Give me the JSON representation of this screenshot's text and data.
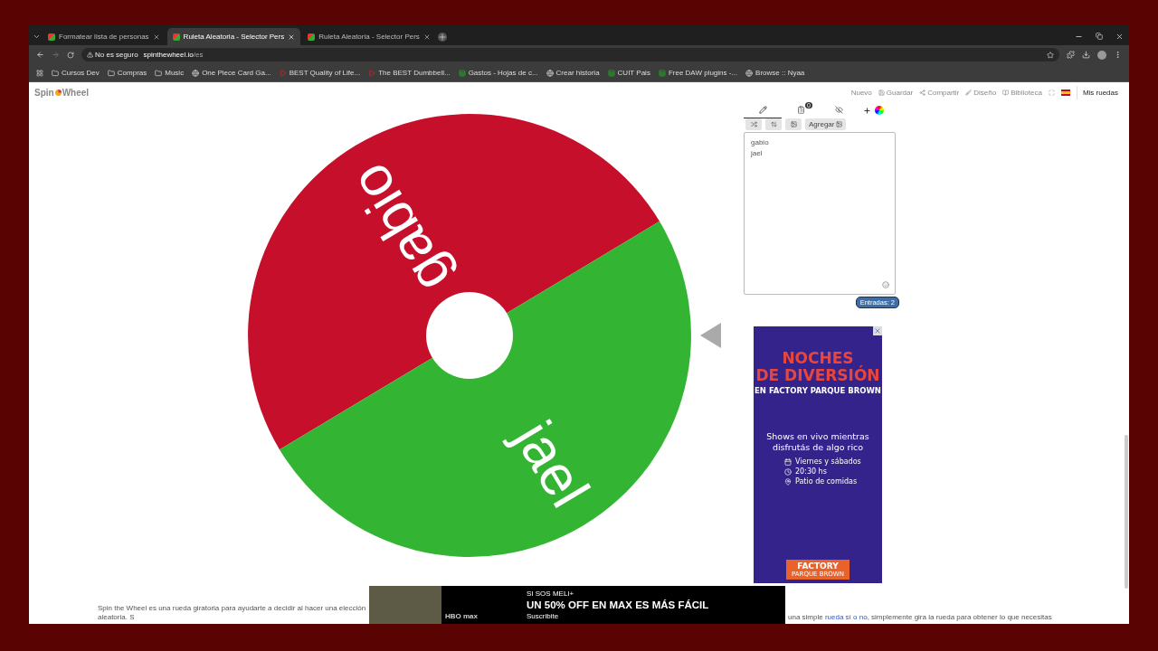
{
  "browser": {
    "tabs": [
      {
        "title": "Formatear lista de personas",
        "selected": false
      },
      {
        "title": "Ruleta Aleatoria - Selector Pers",
        "selected": true
      },
      {
        "title": "Ruleta Aleatoria - Selector Pers",
        "selected": false
      }
    ],
    "security_label": "No es seguro",
    "url_host": "spinthewheel.io",
    "url_path": "/es",
    "bookmarks": [
      {
        "label": "Cursos Dev",
        "kind": "folder"
      },
      {
        "label": "Compras",
        "kind": "folder"
      },
      {
        "label": "Music",
        "kind": "folder"
      },
      {
        "label": "One Piece Card Ga...",
        "kind": "page"
      },
      {
        "label": "BEST Quality of Life...",
        "kind": "video"
      },
      {
        "label": "The BEST Dumbbell...",
        "kind": "video"
      },
      {
        "label": "Gastos - Hojas de c...",
        "kind": "sheet"
      },
      {
        "label": "Crear historia",
        "kind": "page"
      },
      {
        "label": "CUIT Pais",
        "kind": "sheet"
      },
      {
        "label": "Free DAW plugins -...",
        "kind": "sheet"
      },
      {
        "label": "Browse :: Nyaa",
        "kind": "page"
      }
    ]
  },
  "app": {
    "logo": {
      "part_1": "Spin",
      "part_2": "Wheel"
    },
    "nav": [
      {
        "label": "Nuevo",
        "kind": "plain"
      },
      {
        "label": "Guardar",
        "kind": "save"
      },
      {
        "label": "Compartir",
        "kind": "share"
      },
      {
        "label": "Diseño",
        "kind": "design"
      },
      {
        "label": "Biblioteca",
        "kind": "library"
      }
    ],
    "my_wheels": "Mis ruedas"
  },
  "wheel": {
    "segments": [
      {
        "label": "gabio",
        "color": "#c60f2a"
      },
      {
        "label": "jael",
        "color": "#33b533"
      }
    ]
  },
  "editor": {
    "tabs": [
      {
        "kind": "edit",
        "selected": true
      },
      {
        "kind": "results",
        "badge": "0",
        "selected": false
      },
      {
        "kind": "hidden",
        "selected": false
      }
    ],
    "add_image_label": "Agregar",
    "entries": [
      "gabio",
      "jael"
    ],
    "entries_count": "Entradas: 2"
  },
  "ad": {
    "title_1": "NOCHES",
    "title_2": "DE DIVERSIÓN",
    "subtitle": "EN FACTORY PARQUE BROWN",
    "body_1": "Shows en vivo mientras",
    "body_2": "disfrutás de algo rico",
    "details": [
      {
        "kind": "calendar",
        "text": "Viernes y sábados"
      },
      {
        "kind": "clock",
        "text": "20:30 hs"
      },
      {
        "kind": "pin",
        "text": "Patio de comidas"
      }
    ],
    "brand_1": "FACTORY",
    "brand_2": "PARQUE BROWN"
  },
  "banner": {
    "logo": "HBO max",
    "kicker": "SI SOS MELI+",
    "headline": "UN 50% OFF EN MAX ES MÁS FÁCIL",
    "cta": "Suscribite"
  },
  "footer": {
    "left_text": "Spin the Wheel es una rueda giratoria para ayudarte a decidir al hacer una elección aleatoria. S",
    "right_before": "una simple",
    "right_link": "rueda sí o no",
    "right_after": ", simplemente gira la rueda para obtener lo que necesitas"
  }
}
